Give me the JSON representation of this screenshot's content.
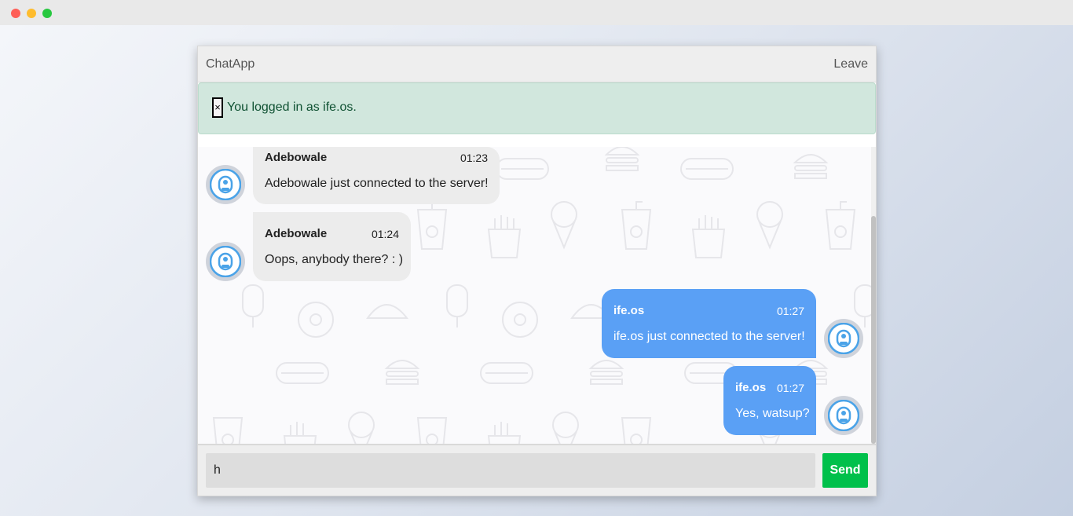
{
  "app": {
    "brand": "ChatApp",
    "leave_label": "Leave"
  },
  "alert": {
    "close_glyph": "×",
    "text": "You logged in as ife.os."
  },
  "messages": [
    {
      "author": "Adebowale",
      "time": "01:23",
      "text": "Adebowale just connected to the server!",
      "direction": "incoming"
    },
    {
      "author": "Adebowale",
      "time": "01:24",
      "text": "Oops, anybody there? : )",
      "direction": "incoming"
    },
    {
      "author": "ife.os",
      "time": "01:27",
      "text": "ife.os just connected to the server!",
      "direction": "outgoing"
    },
    {
      "author": "ife.os",
      "time": "01:27",
      "text": "Yes, watsup?",
      "direction": "outgoing"
    }
  ],
  "composer": {
    "value": "h",
    "send_label": "Send"
  },
  "colors": {
    "outgoing_bubble": "#5aa0f5",
    "incoming_bubble": "#ececec",
    "send_button": "#00c04b",
    "alert_bg": "#d1e7dd"
  },
  "icons": {
    "avatar": "user-avatar-icon",
    "close": "close-icon",
    "background": "food-pattern"
  }
}
